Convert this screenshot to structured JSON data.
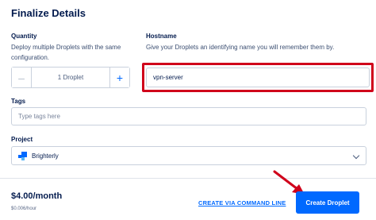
{
  "page": {
    "title": "Finalize Details"
  },
  "quantity": {
    "label": "Quantity",
    "description_line1": "Deploy multiple Droplets with the same",
    "description_line2": "configuration.",
    "minus_symbol": "–",
    "plus_symbol": "+",
    "value": "1  Droplet"
  },
  "hostname": {
    "label": "Hostname",
    "description": "Give your Droplets an identifying name you will remember them by.",
    "value": "vpn-server",
    "highlight_color": "#d0021b"
  },
  "tags": {
    "label": "Tags",
    "placeholder": "Type tags here"
  },
  "project": {
    "label": "Project",
    "selected": "Brighterly",
    "icon": "project-icon"
  },
  "footer": {
    "price": "$4.00/month",
    "price_hourly": "$0.006/hour",
    "cli_link": "CREATE VIA COMMAND LINE",
    "create_button": "Create Droplet",
    "accent_color": "#0069ff"
  }
}
